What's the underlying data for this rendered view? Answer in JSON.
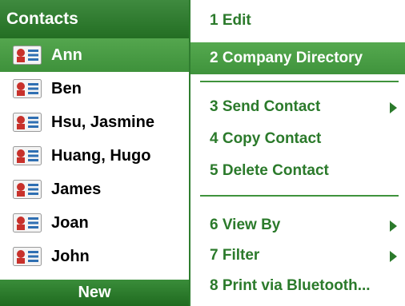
{
  "contacts": {
    "header_title": "Contacts",
    "items": [
      {
        "name": "Ann",
        "selected": true
      },
      {
        "name": "Ben"
      },
      {
        "name": "Hsu, Jasmine"
      },
      {
        "name": "Huang, Hugo"
      },
      {
        "name": "James"
      },
      {
        "name": "Joan"
      },
      {
        "name": "John"
      }
    ],
    "softkey_left": "New"
  },
  "menu": {
    "items": [
      {
        "label": "1 Edit"
      },
      {
        "label": "2 Company Directory",
        "selected": true
      },
      {
        "label": "3 Send Contact",
        "submenu": true
      },
      {
        "label": "4 Copy Contact"
      },
      {
        "label": "5 Delete Contact"
      },
      {
        "label": "6 View By",
        "submenu": true
      },
      {
        "label": "7 Filter",
        "submenu": true
      },
      {
        "label": "8 Print via Bluetooth..."
      }
    ]
  },
  "icons": {
    "contact_card": "contact-card-icon",
    "submenu_arrow": "chevron-right-icon"
  },
  "colors": {
    "accent_green": "#3f933c",
    "menu_text": "#2b7a2b",
    "icon_red": "#c8312b",
    "icon_blue": "#2f6fb2"
  }
}
